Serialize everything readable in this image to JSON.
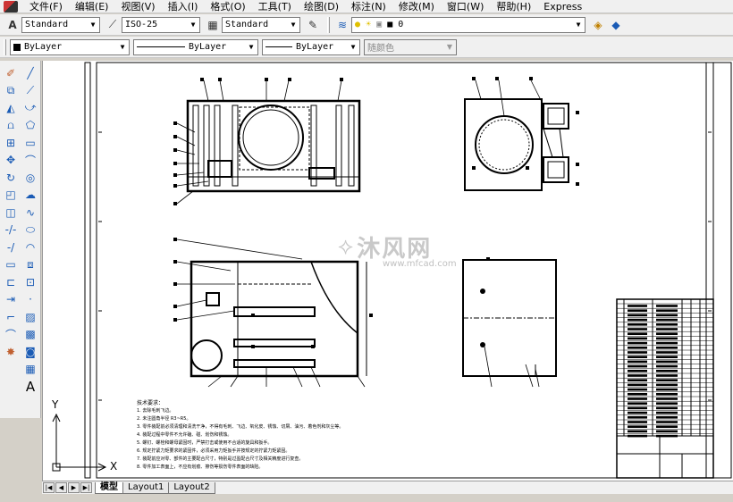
{
  "menu": {
    "items": [
      "文件(F)",
      "编辑(E)",
      "视图(V)",
      "插入(I)",
      "格式(O)",
      "工具(T)",
      "绘图(D)",
      "标注(N)",
      "修改(M)",
      "窗口(W)",
      "帮助(H)",
      "Express"
    ]
  },
  "styles_toolbar": {
    "text_style": "Standard",
    "dim_style": "ISO-25",
    "table_style": "Standard"
  },
  "layer_toolbar": {
    "layer_name": "0"
  },
  "properties_toolbar": {
    "color": "ByLayer",
    "linetype": "ByLayer",
    "lineweight": "ByLayer",
    "plot_style": "随颜色"
  },
  "watermark": {
    "brand": "沐风网",
    "url": "www.mfcad.com"
  },
  "notes": {
    "title": "技术要求：",
    "lines": [
      "1. 去除毛刺飞边。",
      "2. 未注圆角半径 R3~R5。",
      "3. 零件装配前必须清理和清洗干净，不得有毛刺、飞边、氧化皮、锈蚀、切屑、油污、着色剂和灰尘等。",
      "4. 装配过程中零件不允许磕、碰、划伤和锈蚀。",
      "5. 螺钉、螺栓和螺母紧固时，严禁打击或使用不合适的旋具和扳手。",
      "6. 规定拧紧力矩要求的紧固件，必须采用力矩扳手并按规定的拧紧力矩紧固。",
      "7. 装配前应对零、部件的主要配合尺寸，特别是过盈配合尺寸及相关精度进行复查。",
      "8. 零件加工表面上，不应有划痕、擦伤等损伤零件表面的缺陷。"
    ]
  },
  "ucs": {
    "y_label": "Y",
    "x_label": "X"
  },
  "layout_tabs": [
    "模型",
    "Layout1",
    "Layout2"
  ],
  "colors": {
    "accent_blue": "#1a5bb5",
    "canvas_bg": "#ffffff",
    "drawing_line": "#000000"
  }
}
